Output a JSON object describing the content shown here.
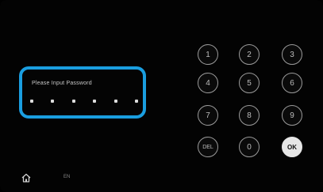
{
  "password": {
    "label": "Please Input Password",
    "dots": 6
  },
  "keypad": {
    "keys": [
      {
        "label": "1"
      },
      {
        "label": "2"
      },
      {
        "label": "3"
      },
      {
        "label": "4"
      },
      {
        "label": "5"
      },
      {
        "label": "6"
      },
      {
        "label": "7"
      },
      {
        "label": "8"
      },
      {
        "label": "9"
      },
      {
        "label": "DEL"
      },
      {
        "label": "0"
      },
      {
        "label": "OK"
      }
    ]
  },
  "footer": {
    "home_icon": "home-icon",
    "mode_text": "EN"
  },
  "colors": {
    "accent": "#1a9ee0",
    "background": "#030303",
    "ok_button": "#e6e6e6"
  }
}
